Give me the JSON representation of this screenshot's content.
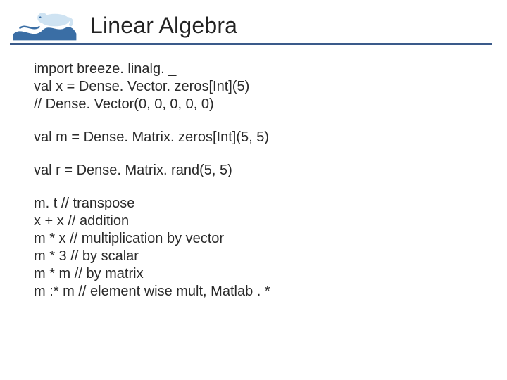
{
  "header": {
    "title": "Linear Algebra"
  },
  "code": {
    "p1_l1": "import breeze. linalg. _",
    "p1_l2": "val x = Dense. Vector. zeros[Int](5)",
    "p1_l3": "// Dense. Vector(0, 0, 0, 0, 0)",
    "p2_l1": "val m = Dense. Matrix. zeros[Int](5, 5)",
    "p3_l1": "val r = Dense. Matrix. rand(5, 5)",
    "p4_l1": "m. t // transpose",
    "p4_l2": "x + x // addition",
    "p4_l3": "m * x // multiplication by vector",
    "p4_l4": "m * 3 // by scalar",
    "p4_l5": "m * m // by matrix",
    "p4_l6": "m :* m // element wise mult, Matlab . *"
  }
}
